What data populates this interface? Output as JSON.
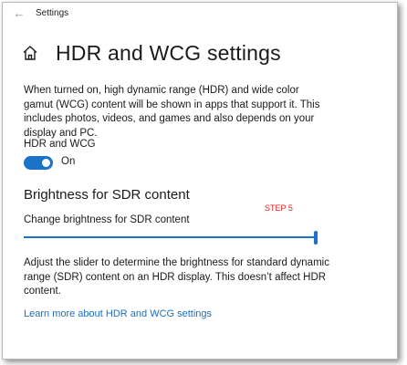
{
  "window": {
    "title": "Settings",
    "back_glyph": "←"
  },
  "header": {
    "icon": "home-icon",
    "title": "HDR and WCG settings"
  },
  "description": "When turned on, high dynamic range (HDR) and wide color gamut (WCG) content will be shown in apps that support it. This includes photos, videos, and games and also depends on your display and PC.",
  "hdr_toggle": {
    "label": "HDR and WCG",
    "state_text": "On",
    "is_on": true
  },
  "sdr_section": {
    "title": "Brightness for SDR content",
    "annotation": "STEP 5",
    "slider_label": "Change brightness for SDR content",
    "slider_value_fraction": 1.0,
    "help_text": "Adjust the slider to determine the brightness for standard dynamic range (SDR) content on an HDR display. This doesn’t affect HDR content."
  },
  "learn_more_link": "Learn more about HDR and WCG settings",
  "colors": {
    "accent": "#1a73c8",
    "link": "#1a6fc0",
    "annotation": "#e02020",
    "track": "#9a9a9a",
    "text": "#1a1a1a"
  }
}
